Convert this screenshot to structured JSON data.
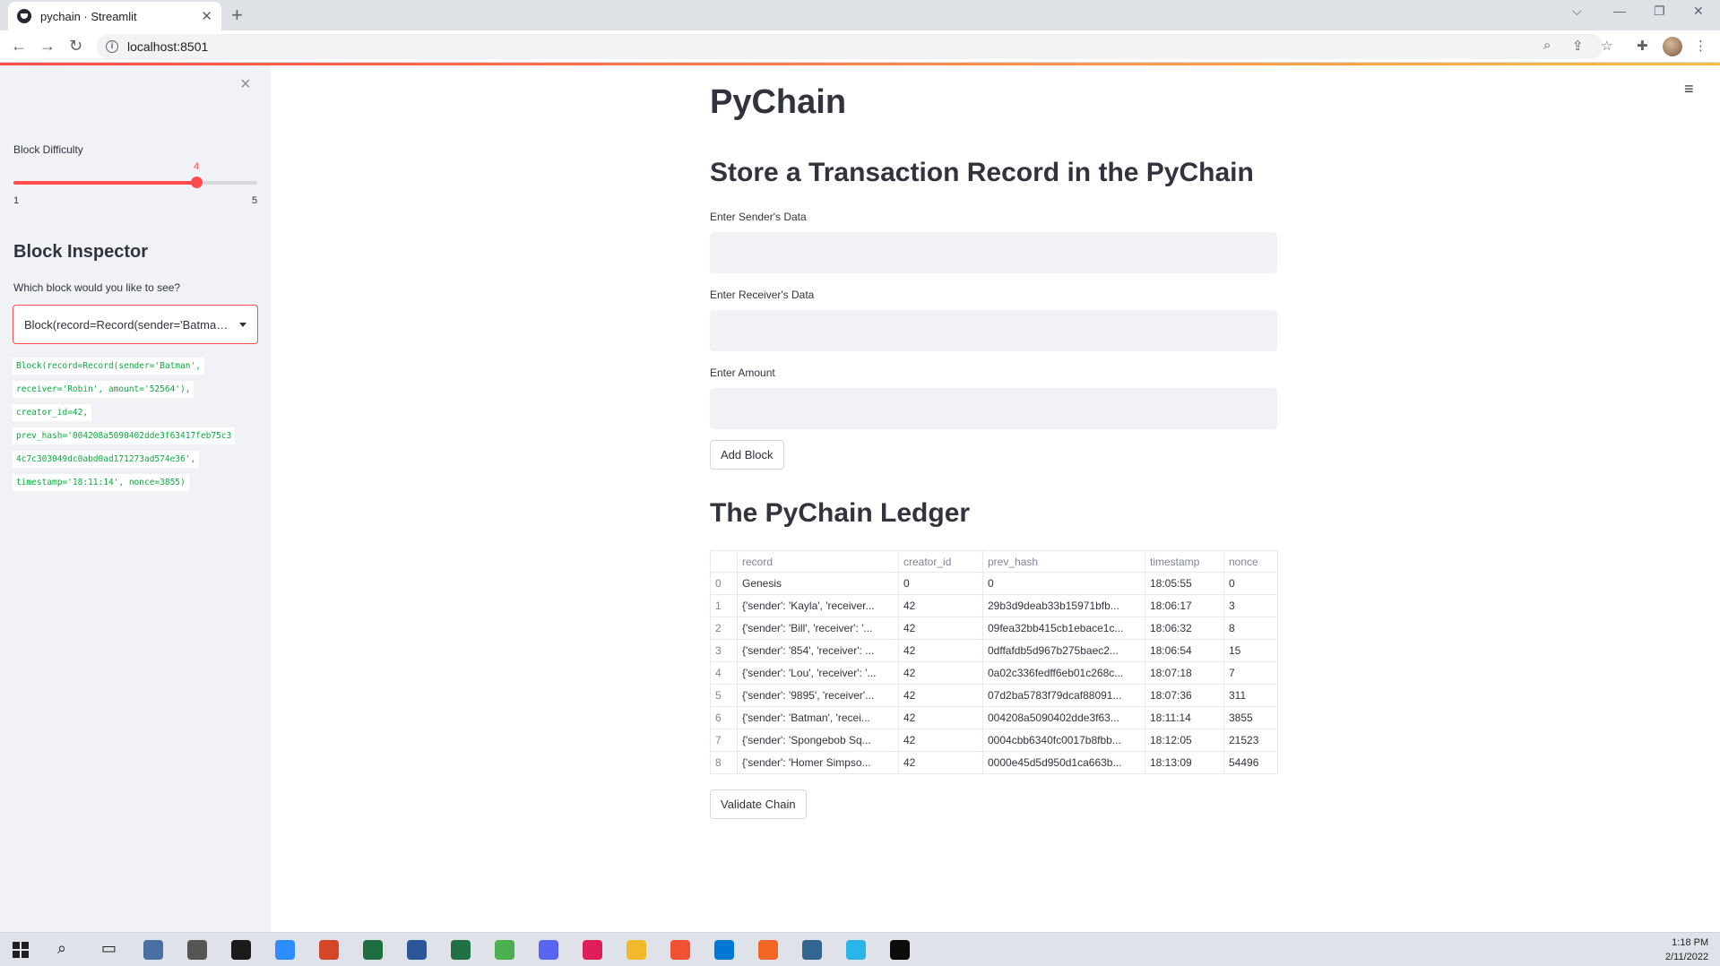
{
  "browser": {
    "tab_title": "pychain · Streamlit",
    "new_tab": "+",
    "url": "localhost:8501",
    "info_icon": "i"
  },
  "sidebar": {
    "close_glyph": "×",
    "slider": {
      "label": "Block Difficulty",
      "min": 1,
      "max": 5,
      "value": 4
    },
    "inspector_heading": "Block Inspector",
    "select_label": "Which block would you like to see?",
    "select_value": "Block(record=Record(sender='Batman', receiver='Robin', amount='52564'), creator_id=42, prev_hash=...",
    "code_lines": [
      "Block(record=Record(sender='Batman',",
      "receiver='Robin', amount='52564'),",
      "creator_id=42,",
      "prev_hash='004208a5090402dde3f63417feb75c3",
      "4c7c303049dc0abd0ad171273ad574e36',",
      "timestamp='18:11:14', nonce=3855)"
    ]
  },
  "main": {
    "title": "PyChain",
    "store_heading": "Store a Transaction Record in the PyChain",
    "sender_label": "Enter Sender's Data",
    "receiver_label": "Enter Receiver's Data",
    "amount_label": "Enter Amount",
    "add_block_button": "Add Block",
    "ledger_heading": "The PyChain Ledger",
    "validate_button": "Validate Chain",
    "menu_glyph": "≡"
  },
  "ledger": {
    "columns": [
      "",
      "record",
      "creator_id",
      "prev_hash",
      "timestamp",
      "nonce"
    ],
    "rows": [
      [
        "0",
        "Genesis",
        "0",
        "0",
        "18:05:55",
        "0"
      ],
      [
        "1",
        "{'sender': 'Kayla', 'receiver...",
        "42",
        "29b3d9deab33b15971bfb...",
        "18:06:17",
        "3"
      ],
      [
        "2",
        "{'sender': 'Bill', 'receiver': '...",
        "42",
        "09fea32bb415cb1ebace1c...",
        "18:06:32",
        "8"
      ],
      [
        "3",
        "{'sender': '854', 'receiver': ...",
        "42",
        "0dffafdb5d967b275baec2...",
        "18:06:54",
        "15"
      ],
      [
        "4",
        "{'sender': 'Lou', 'receiver': '...",
        "42",
        "0a02c336fedff6eb01c268c...",
        "18:07:18",
        "7"
      ],
      [
        "5",
        "{'sender': '9895', 'receiver'...",
        "42",
        "07d2ba5783f79dcaf88091...",
        "18:07:36",
        "311"
      ],
      [
        "6",
        "{'sender': 'Batman', 'recei...",
        "42",
        "004208a5090402dde3f63...",
        "18:11:14",
        "3855"
      ],
      [
        "7",
        "{'sender': 'Spongebob Sq...",
        "42",
        "0004cbb6340fc0017b8fbb...",
        "18:12:05",
        "21523"
      ],
      [
        "8",
        "{'sender': 'Homer Simpso...",
        "42",
        "0000e45d5d950d1ca663b...",
        "18:13:09",
        "54496"
      ]
    ]
  },
  "taskbar": {
    "time": "1:18 PM",
    "date": "2/11/2022",
    "icons": [
      {
        "name": "search-icon",
        "color": "#222222"
      },
      {
        "name": "task-view-icon",
        "color": "#222222"
      },
      {
        "name": "calculator-icon",
        "color": "#4a6fa5"
      },
      {
        "name": "camera-icon",
        "color": "#555555"
      },
      {
        "name": "github-desktop-icon",
        "color": "#1b1b1b"
      },
      {
        "name": "zoom-icon",
        "color": "#2d8cff"
      },
      {
        "name": "powerpoint-icon",
        "color": "#d24726"
      },
      {
        "name": "excel-icon",
        "color": "#1d6f42"
      },
      {
        "name": "word-icon",
        "color": "#2b579a"
      },
      {
        "name": "spreadsheet-icon",
        "color": "#207245"
      },
      {
        "name": "chrome-icon",
        "color": "#4caf50"
      },
      {
        "name": "discord-icon",
        "color": "#5865f2"
      },
      {
        "name": "slack-icon",
        "color": "#e01e5a"
      },
      {
        "name": "file-explorer-icon",
        "color": "#f2b92a"
      },
      {
        "name": "git-icon",
        "color": "#f05133"
      },
      {
        "name": "vscode-icon",
        "color": "#0078d4"
      },
      {
        "name": "compass-icon",
        "color": "#f26522"
      },
      {
        "name": "postgres-icon",
        "color": "#336791"
      },
      {
        "name": "snowflake-icon",
        "color": "#29b5e8"
      },
      {
        "name": "terminal-icon",
        "color": "#0c0c0c"
      }
    ]
  }
}
